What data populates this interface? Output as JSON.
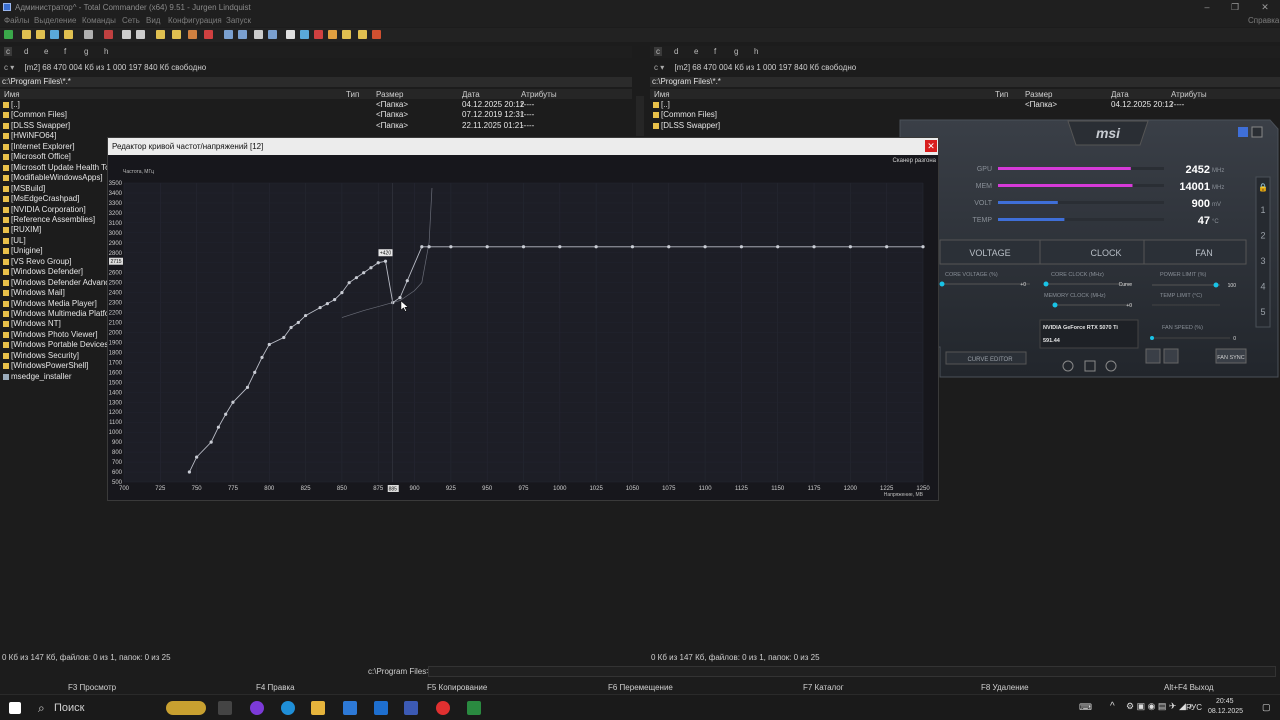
{
  "window": {
    "title": "Администратор^ - Total Commander (x64) 9.51 - Jurgen Lindquist"
  },
  "menu": [
    "Файлы",
    "Выделение",
    "Команды",
    "Сеть",
    "Вид",
    "Конфигурация",
    "Запуск"
  ],
  "menu_right": "Справка",
  "left_panel": {
    "drives": [
      "c",
      "d",
      "e",
      "f",
      "g",
      "h"
    ],
    "drive_info": "[m2]  68 470 004 Кб из 1 000 197 840 Кб свободно",
    "path": "c:\\Program Files\\*.*",
    "columns": {
      "name": "Имя",
      "type": "Тип",
      "size": "Размер",
      "date": "Дата",
      "attr": "Атрибуты"
    },
    "files": [
      {
        "name": "[..]",
        "size": "<Папка>",
        "date": "04.12.2025 20:12",
        "attr": "r----"
      },
      {
        "name": "[Common Files]",
        "size": "<Папка>",
        "date": "07.12.2019 12:31",
        "attr": "r----"
      },
      {
        "name": "[DLSS Swapper]",
        "size": "<Папка>",
        "date": "22.11.2025 01:21",
        "attr": "-----"
      },
      {
        "name": "[HWiNFO64]",
        "size": "",
        "date": "",
        "attr": ""
      },
      {
        "name": "[Internet Explorer]",
        "size": "",
        "date": "",
        "attr": ""
      },
      {
        "name": "[Microsoft Office]",
        "size": "",
        "date": "",
        "attr": ""
      },
      {
        "name": "[Microsoft Update Health Tools]",
        "size": "",
        "date": "",
        "attr": ""
      },
      {
        "name": "[ModifiableWindowsApps]",
        "size": "",
        "date": "",
        "attr": ""
      },
      {
        "name": "[MSBuild]",
        "size": "",
        "date": "",
        "attr": ""
      },
      {
        "name": "[MsEdgeCrashpad]",
        "size": "",
        "date": "",
        "attr": ""
      },
      {
        "name": "[NVIDIA Corporation]",
        "size": "",
        "date": "",
        "attr": ""
      },
      {
        "name": "[Reference Assemblies]",
        "size": "",
        "date": "",
        "attr": ""
      },
      {
        "name": "[RUXIM]",
        "size": "",
        "date": "",
        "attr": ""
      },
      {
        "name": "[UL]",
        "size": "",
        "date": "",
        "attr": ""
      },
      {
        "name": "[Unigine]",
        "size": "",
        "date": "",
        "attr": ""
      },
      {
        "name": "[VS Revo Group]",
        "size": "",
        "date": "",
        "attr": ""
      },
      {
        "name": "[Windows Defender]",
        "size": "",
        "date": "",
        "attr": ""
      },
      {
        "name": "[Windows Defender Advanced Threat Protection]",
        "size": "",
        "date": "",
        "attr": ""
      },
      {
        "name": "[Windows Mail]",
        "size": "",
        "date": "",
        "attr": ""
      },
      {
        "name": "[Windows Media Player]",
        "size": "",
        "date": "",
        "attr": ""
      },
      {
        "name": "[Windows Multimedia Platform]",
        "size": "",
        "date": "",
        "attr": ""
      },
      {
        "name": "[Windows NT]",
        "size": "",
        "date": "",
        "attr": ""
      },
      {
        "name": "[Windows Photo Viewer]",
        "size": "",
        "date": "",
        "attr": ""
      },
      {
        "name": "[Windows Portable Devices]",
        "size": "",
        "date": "",
        "attr": ""
      },
      {
        "name": "[Windows Security]",
        "size": "",
        "date": "",
        "attr": ""
      },
      {
        "name": "[WindowsPowerShell]",
        "size": "",
        "date": "",
        "attr": ""
      },
      {
        "name": "msedge_installer",
        "size": "",
        "date": "",
        "attr": ""
      }
    ],
    "status": "0 Кб из 147 Кб, файлов: 0 из 1, папок: 0 из 25"
  },
  "right_panel": {
    "drives": [
      "c",
      "d",
      "e",
      "f",
      "g",
      "h"
    ],
    "drive_info": "[m2]  68 470 004 Кб из 1 000 197 840 Кб свободно",
    "path": "c:\\Program Files\\*.*",
    "columns": {
      "name": "Имя",
      "type": "Тип",
      "size": "Размер",
      "date": "Дата",
      "attr": "Атрибуты"
    },
    "files": [
      {
        "name": "[..]",
        "size": "<Папка>",
        "date": "04.12.2025 20:12",
        "attr": "r----"
      },
      {
        "name": "[Common Files]",
        "size": "",
        "date": "",
        "attr": ""
      },
      {
        "name": "[DLSS Swapper]",
        "size": "",
        "date": "",
        "attr": ""
      }
    ],
    "status": "0 Кб из 147 Кб, файлов: 0 из 1, папок: 0 из 25"
  },
  "cmdline": {
    "label": "c:\\Program Files>",
    "value": ""
  },
  "fkeys": [
    "F3 Просмотр",
    "F4 Правка",
    "F5 Копирование",
    "F6 Перемещение",
    "F7 Каталог",
    "F8 Удаление",
    "Alt+F4 Выход"
  ],
  "msi": {
    "brand": "msi",
    "monitors": [
      {
        "label": "GPU",
        "value": "2452",
        "unit": "MHz"
      },
      {
        "label": "MEM",
        "value": "14001",
        "unit": "MHz"
      },
      {
        "label": "VOLT",
        "value": "900",
        "unit": "mV"
      },
      {
        "label": "TEMP",
        "value": "47",
        "unit": "°C"
      }
    ],
    "tabs": [
      "VOLTAGE",
      "CLOCK",
      "FAN"
    ],
    "core_voltage_label": "CORE VOLTAGE (%)",
    "core_voltage_value": "+0",
    "core_clock_label": "CORE CLOCK (MHz)",
    "core_clock_value": "Curve",
    "memory_clock_label": "MEMORY CLOCK (MHz)",
    "memory_clock_value": "+0",
    "power_limit_label": "POWER LIMIT (%)",
    "power_limit_value": "100",
    "temp_limit_label": "TEMP LIMIT (°C)",
    "fan_speed_label": "FAN SPEED (%)",
    "fan_speed_value": "0",
    "gpu_name": "NVIDIA GeForce RTX 5070 Ti",
    "driver": "591.44",
    "curve_editor": "CURVE EDITOR",
    "fan_sync": "FAN SYNC",
    "profiles": [
      "1",
      "2",
      "3",
      "4",
      "5"
    ],
    "fill": {
      "gpu": 0.8,
      "mem": 0.81,
      "volt": 0.36,
      "temp": 0.4
    },
    "colors": {
      "accent": "#d63ad8",
      "cyan": "#19c3e6",
      "blue": "#3f6fd8"
    }
  },
  "editor": {
    "title": "Редактор кривой частот/напряжений [12]",
    "scanner": "Сканер разгона",
    "tooltip": "+420",
    "cursor_voltage": "885",
    "cursor_freq": "2715"
  },
  "chart_data": {
    "type": "line",
    "ylabel": "Частота, МГц",
    "xlabel": "Напряжение, МВ",
    "xlim": [
      700,
      1250
    ],
    "ylim": [
      500,
      3500
    ],
    "xticks": [
      700,
      725,
      750,
      775,
      800,
      825,
      850,
      875,
      900,
      925,
      950,
      975,
      1000,
      1025,
      1050,
      1075,
      1100,
      1125,
      1150,
      1175,
      1200,
      1225,
      1250
    ],
    "yticks": [
      500,
      600,
      700,
      800,
      900,
      1000,
      1100,
      1200,
      1300,
      1400,
      1500,
      1600,
      1700,
      1800,
      1900,
      2000,
      2100,
      2200,
      2300,
      2400,
      2500,
      2600,
      2700,
      2800,
      2900,
      3000,
      3100,
      3200,
      3300,
      3400,
      3500
    ],
    "series": [
      {
        "points": [
          [
            745,
            600
          ],
          [
            750,
            750
          ],
          [
            760,
            900
          ],
          [
            765,
            1050
          ],
          [
            770,
            1180
          ],
          [
            775,
            1300
          ],
          [
            785,
            1450
          ],
          [
            790,
            1600
          ],
          [
            795,
            1750
          ],
          [
            800,
            1880
          ],
          [
            810,
            1950
          ],
          [
            815,
            2050
          ],
          [
            820,
            2100
          ],
          [
            825,
            2170
          ],
          [
            835,
            2250
          ],
          [
            840,
            2290
          ],
          [
            845,
            2330
          ],
          [
            850,
            2400
          ],
          [
            855,
            2500
          ],
          [
            860,
            2550
          ],
          [
            865,
            2600
          ],
          [
            870,
            2650
          ],
          [
            875,
            2700
          ],
          [
            880,
            2715
          ],
          [
            885,
            2300
          ],
          [
            890,
            2350
          ],
          [
            895,
            2520
          ],
          [
            905,
            2860
          ],
          [
            910,
            2860
          ],
          [
            925,
            2860
          ],
          [
            950,
            2860
          ],
          [
            975,
            2860
          ],
          [
            1000,
            2860
          ],
          [
            1025,
            2860
          ],
          [
            1050,
            2860
          ],
          [
            1075,
            2860
          ],
          [
            1100,
            2860
          ],
          [
            1125,
            2860
          ],
          [
            1150,
            2860
          ],
          [
            1175,
            2860
          ],
          [
            1200,
            2860
          ],
          [
            1225,
            2860
          ],
          [
            1250,
            2860
          ]
        ]
      },
      {
        "points": [
          [
            850,
            2150
          ],
          [
            865,
            2220
          ],
          [
            880,
            2280
          ],
          [
            890,
            2320
          ],
          [
            900,
            2420
          ],
          [
            905,
            2500
          ],
          [
            910,
            2900
          ],
          [
            912,
            3450
          ]
        ]
      }
    ]
  }
}
